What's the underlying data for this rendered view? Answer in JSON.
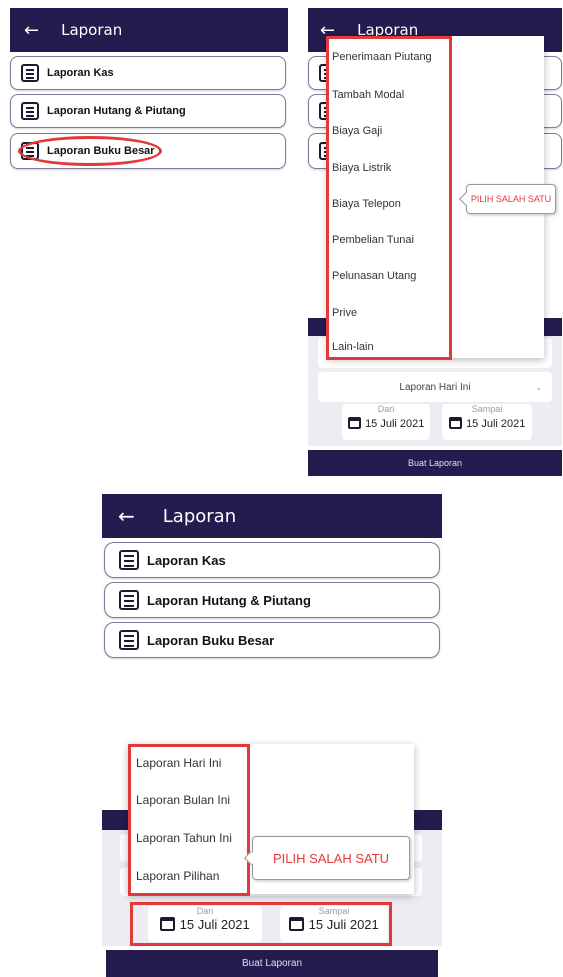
{
  "header": {
    "back_icon": "arrow-left-icon",
    "title": "Laporan"
  },
  "report_menu": {
    "items": [
      {
        "label": "Laporan Kas",
        "icon": "report-icon"
      },
      {
        "label": "Laporan Hutang & Piutang",
        "icon": "report-icon"
      },
      {
        "label": "Laporan Buku Besar",
        "icon": "report-icon"
      }
    ]
  },
  "category_dropdown": {
    "options": [
      "Penerimaan Piutang",
      "Tambah Modal",
      "Biaya Gaji",
      "Biaya Listrik",
      "Biaya Telepon",
      "Pembelian Tunai",
      "Pelunasan Utang",
      "Prive",
      "Lain-lain"
    ]
  },
  "period_select": {
    "selected": "Laporan Hari Ini"
  },
  "period_dropdown": {
    "options": [
      "Laporan Hari Ini",
      "Laporan Bulan Ini",
      "Laporan Tahun Ini",
      "Laporan Pilihan"
    ]
  },
  "callout": {
    "text": "PILIH SALAH SATU"
  },
  "date_range": {
    "from_label": "Dari",
    "from_value": "15 Juli 2021",
    "to_label": "Sampai",
    "to_value": "15 Juli 2021"
  },
  "submit_label": "Buat Laporan",
  "colors": {
    "appbar": "#241b4f",
    "highlight": "#e23a3a",
    "panel": "#ececf2"
  }
}
